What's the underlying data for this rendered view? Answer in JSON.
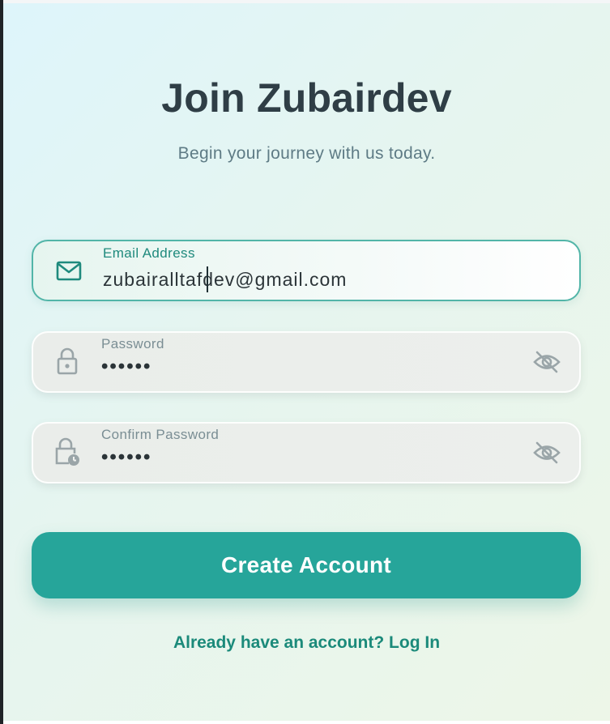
{
  "header": {
    "title": "Join Zubairdev",
    "subtitle": "Begin your journey with us today."
  },
  "form": {
    "email": {
      "label": "Email Address",
      "value": "zubairalltafdev@gmail.com",
      "icon": "mail-icon",
      "focused": true
    },
    "password": {
      "label": "Password",
      "value": "••••••",
      "icon": "lock-icon",
      "toggle_icon": "eye-off-icon"
    },
    "confirm_password": {
      "label": "Confirm Password",
      "value": "••••••",
      "icon": "lock-clock-icon",
      "toggle_icon": "eye-off-icon"
    },
    "submit_label": "Create Account"
  },
  "footer": {
    "login_prompt": "Already have an account? Log In"
  },
  "colors": {
    "accent": "#26a59a",
    "title": "#2f3e46",
    "subtitle": "#5e7b85",
    "link": "#1b8a7a"
  }
}
